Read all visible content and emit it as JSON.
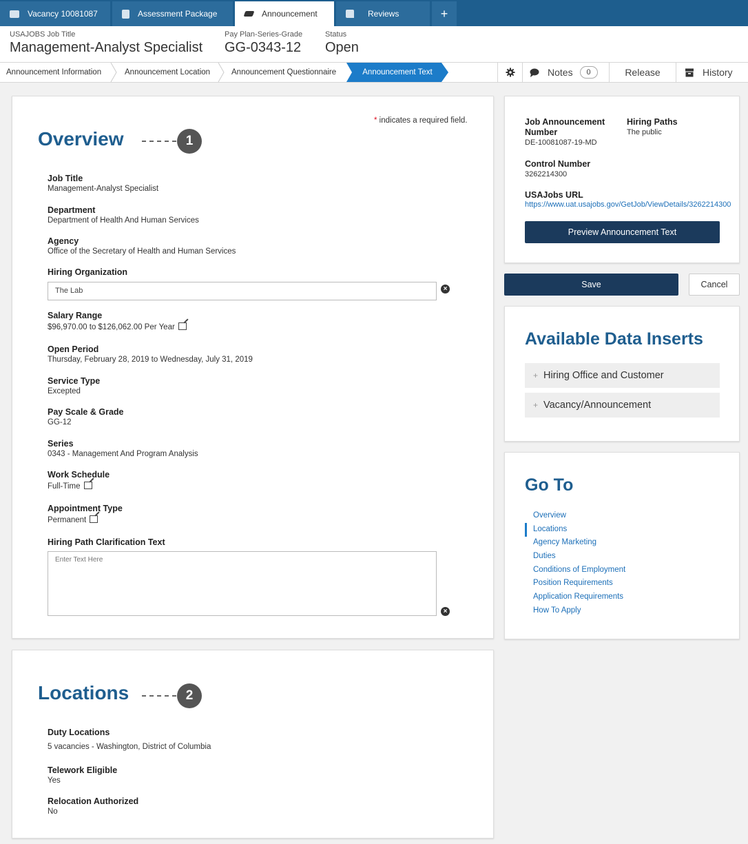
{
  "top_tabs": [
    {
      "label": "Vacancy 10081087",
      "icon": "folder-icon"
    },
    {
      "label": "Assessment Package",
      "icon": "copy-icon"
    },
    {
      "label": "Announcement",
      "icon": "megaphone-icon"
    },
    {
      "label": "Reviews",
      "icon": "thumbs-up-icon"
    },
    {
      "label": "+",
      "icon": "add-tab-icon"
    }
  ],
  "job_header": {
    "title_label": "USAJOBS Job Title",
    "title_value": "Management-Analyst Specialist",
    "grade_label": "Pay Plan-Series-Grade",
    "grade_value": "GG-0343-12",
    "status_label": "Status",
    "status_value": "Open"
  },
  "breadcrumbs": [
    "Announcement Information",
    "Announcement Location",
    "Announcement Questionnaire",
    "Announcement Text"
  ],
  "toolbar": {
    "notes_label": "Notes",
    "notes_count": "0",
    "release_label": "Release",
    "history_label": "History"
  },
  "required_note": "indicates a required field.",
  "overview": {
    "title": "Overview",
    "badge": "1",
    "fields": {
      "job_title_label": "Job Title",
      "job_title_value": "Management-Analyst Specialist",
      "department_label": "Department",
      "department_value": "Department of Health And Human Services",
      "agency_label": "Agency",
      "agency_value": "Office of the Secretary of Health and Human Services",
      "hiring_org_label": "Hiring Organization",
      "hiring_org_value": "The Lab",
      "salary_label": "Salary Range",
      "salary_value": "$96,970.00 to $126,062.00 Per Year",
      "open_period_label": "Open Period",
      "open_period_value": "Thursday, February 28, 2019 to Wednesday, July 31, 2019",
      "service_type_label": "Service Type",
      "service_type_value": "Excepted",
      "pay_scale_label": "Pay Scale & Grade",
      "pay_scale_value": "GG-12",
      "series_label": "Series",
      "series_value": "0343 - Management And Program Analysis",
      "work_schedule_label": "Work Schedule",
      "work_schedule_value": "Full-Time",
      "appointment_label": "Appointment Type",
      "appointment_value": "Permanent",
      "clarification_label": "Hiring Path Clarification Text",
      "clarification_placeholder": "Enter Text Here"
    }
  },
  "locations": {
    "title": "Locations",
    "badge": "2",
    "duty_label": "Duty Locations",
    "duty_value": "5 vacancies - Washington, District of Columbia",
    "telework_label": "Telework Eligible",
    "telework_value": "Yes",
    "relocation_label": "Relocation Authorized",
    "relocation_value": "No"
  },
  "side_info": {
    "announcement_number_label_1": "Job Announcement",
    "announcement_number_label_2": "Number",
    "announcement_number_value": "DE-10081087-19-MD",
    "hiring_paths_label": "Hiring Paths",
    "hiring_paths_value": "The public",
    "control_number_label": "Control Number",
    "control_number_value": "3262214300",
    "url_label": "USAJobs URL",
    "url_value": "https://www.uat.usajobs.gov/GetJob/ViewDetails/3262214300",
    "preview_button": "Preview Announcement Text"
  },
  "actions": {
    "save": "Save",
    "cancel": "Cancel"
  },
  "data_inserts": {
    "title": "Available Data Inserts",
    "items": [
      "Hiring Office and Customer",
      "Vacancy/Announcement"
    ]
  },
  "goto": {
    "title": "Go To",
    "items": [
      "Overview",
      "Locations",
      "Agency Marketing",
      "Duties",
      "Conditions of Employment",
      "Position Requirements",
      "Application Requirements",
      "How To Apply"
    ]
  },
  "colors": {
    "primary": "#1f5e8f",
    "active_tab": "#1c7cc9",
    "dark_button": "#1b3a5c",
    "link": "#1c6fb8"
  }
}
